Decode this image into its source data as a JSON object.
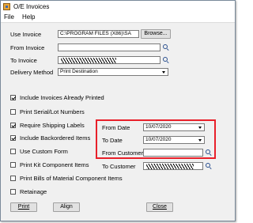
{
  "window": {
    "title": "O/E Invoices"
  },
  "menu": {
    "file": "File",
    "help": "Help"
  },
  "form": {
    "use_invoice_label": "Use Invoice",
    "use_invoice_value": "C:\\PROGRAM FILES (X86)\\SA",
    "browse_label": "Browse...",
    "from_invoice_label": "From Invoice",
    "from_invoice_value": "",
    "to_invoice_label": "To Invoice",
    "delivery_method_label": "Delivery Method",
    "delivery_method_value": "Print Destination"
  },
  "options": [
    {
      "label": "Include Invoices Already Printed",
      "checked": true
    },
    {
      "label": "Print Serial/Lot Numbers",
      "checked": false
    },
    {
      "label": "Require Shipping Labels",
      "checked": true
    },
    {
      "label": "Include Backordered Items",
      "checked": true
    },
    {
      "label": "Use Custom Form",
      "checked": false
    },
    {
      "label": "Print Kit Component Items",
      "checked": false
    },
    {
      "label": "Print Bills of Material Component Items",
      "checked": false
    },
    {
      "label": "Retainage",
      "checked": false
    }
  ],
  "range": {
    "from_date_label": "From Date",
    "from_date_value": "10/07/2020",
    "to_date_label": "To Date",
    "to_date_value": "10/07/2020",
    "from_customer_label": "From Customer",
    "from_customer_value": "",
    "to_customer_label": "To Customer"
  },
  "buttons": {
    "print": "Print",
    "align": "Align",
    "close": "Close"
  },
  "colors": {
    "highlight": "#e8202a",
    "window_bg": "#f0f0f0"
  },
  "icons": [
    "app-icon",
    "search-icon",
    "dropdown-arrow-icon"
  ]
}
